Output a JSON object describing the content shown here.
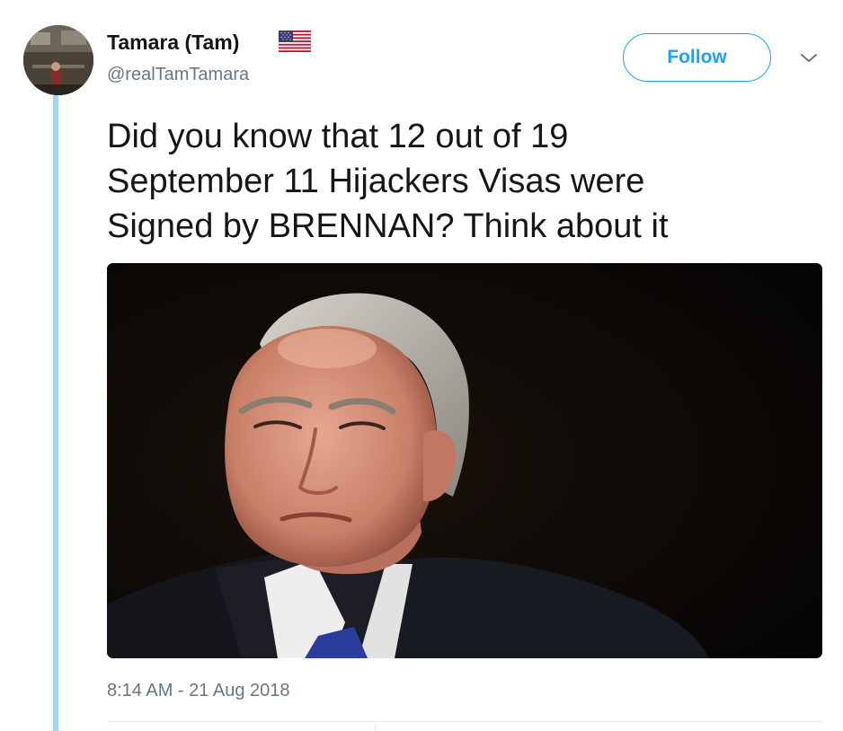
{
  "tweet": {
    "author": {
      "name": "Tamara (Tam)",
      "handle": "@realTamTamara",
      "flag_icon": "us-flag-icon"
    },
    "follow_label": "Follow",
    "menu_icon": "chevron-down-icon",
    "text": "Did you know that 12 out of 19\nSeptember 11 Hijackers Visas were\nSigned by BRENNAN? Think about it",
    "media": {
      "type": "photo",
      "subject": "man in dark suit with blue tie against dark background"
    },
    "timestamp": "8:14 AM - 21 Aug 2018"
  },
  "colors": {
    "accent": "#1da1f2",
    "thread_line": "#a6d4f5",
    "secondary_text": "#657786",
    "primary_text": "#14171a",
    "divider": "#e6ecf0"
  }
}
